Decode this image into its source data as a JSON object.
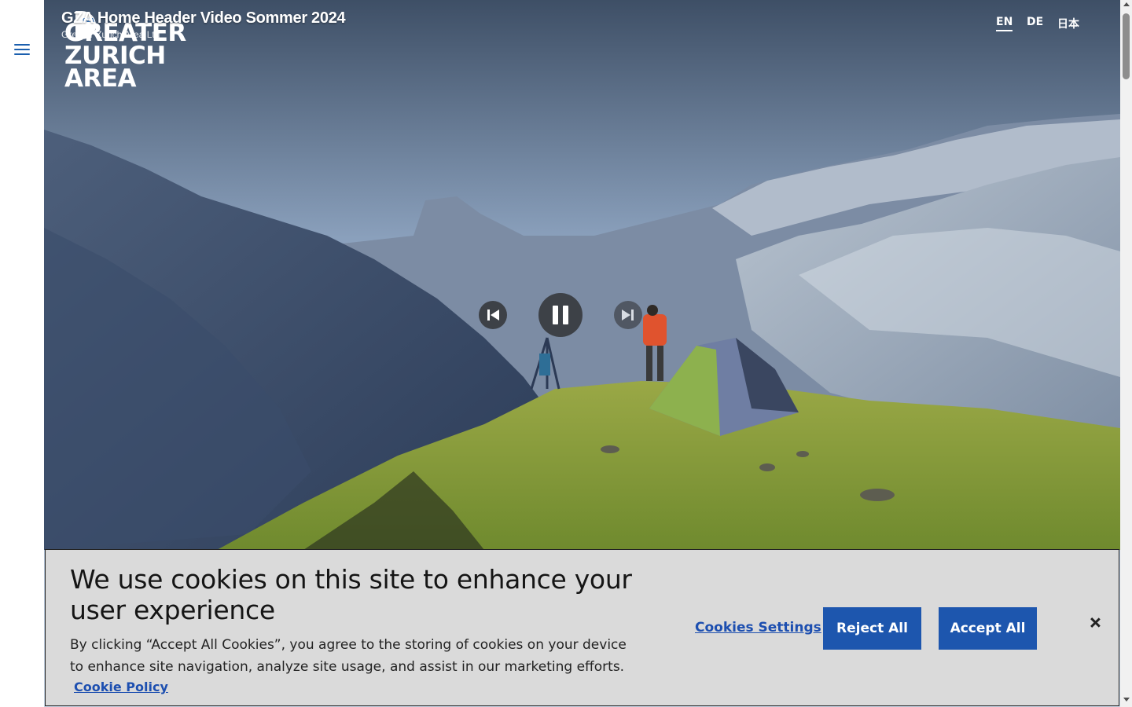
{
  "site": {
    "logo_lines": [
      "GREATER",
      "ZURICH",
      "AREA"
    ],
    "menu_icon": "hamburger-menu-icon"
  },
  "video": {
    "title": "GZA Home Header Video Sommer 2024",
    "channel": "Greater Zurich Area Ltd",
    "channel_avatar_text": "GZA",
    "controls": {
      "previous_icon": "skip-previous-icon",
      "pause_icon": "pause-icon",
      "next_icon": "skip-next-icon"
    }
  },
  "languages": {
    "items": [
      "EN",
      "DE",
      "日本"
    ],
    "active": "EN"
  },
  "cookie_banner": {
    "heading": "We use cookies on this site to enhance your user experience",
    "body": "By clicking “Accept All Cookies”, you agree to the storing of cookies on your device to enhance site navigation, analyze site usage, and assist in our marketing efforts.",
    "policy_link": "Cookie Policy",
    "settings_link": "Cookies Settings",
    "reject_label": "Reject All",
    "accept_label": "Accept All",
    "close_icon": "close-icon",
    "button_color": "#1d56ae",
    "link_color": "#1d4fb0",
    "background_color": "#dadada"
  }
}
